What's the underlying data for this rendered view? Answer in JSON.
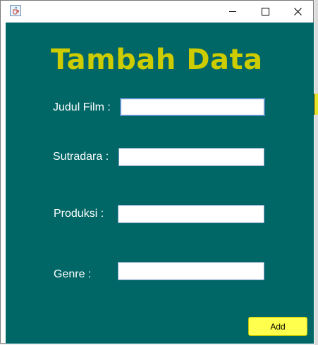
{
  "window": {
    "title": "",
    "icon": "java-cup-icon",
    "controls": {
      "minimize": "minimize-icon",
      "maximize": "maximize-icon",
      "close": "close-icon"
    }
  },
  "form": {
    "heading": "Tambah Data",
    "fields": [
      {
        "label": "Judul Film :",
        "value": "",
        "placeholder": ""
      },
      {
        "label": "Sutradara :",
        "value": "",
        "placeholder": ""
      },
      {
        "label": "Produksi :",
        "value": "",
        "placeholder": ""
      },
      {
        "label": "Genre :",
        "value": "",
        "placeholder": ""
      }
    ],
    "add_label": "Add"
  },
  "colors": {
    "panel_background": "#006666",
    "heading": "#cccc00",
    "label": "#ffffff",
    "button": "#ffff4d"
  }
}
